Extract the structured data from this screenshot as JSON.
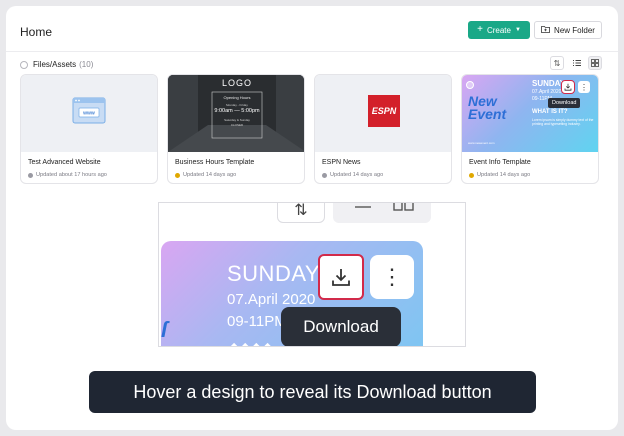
{
  "header": {
    "title": "Home",
    "create_label": "Create",
    "new_folder_label": "New Folder"
  },
  "files": {
    "label": "Files/Assets",
    "count": "(10)"
  },
  "cards": [
    {
      "name": "Test Advanced Website",
      "updated": "Updated about 17 hours ago",
      "status_color": "#9a9aa3"
    },
    {
      "name": "Business Hours Template",
      "updated": "Updated 14 days ago",
      "status_color": "#e0a800"
    },
    {
      "name": "ESPN News",
      "updated": "Updated 14 days ago",
      "status_color": "#9a9aa3"
    },
    {
      "name": "Event Info Template",
      "updated": "Updated 14 days ago",
      "status_color": "#e0a800"
    }
  ],
  "thumb_business": {
    "logo": "LOGO",
    "hours_title": "Opening Hours",
    "days": "Monday - Friday",
    "time": "9:00am — 5:00pm",
    "weekend": "Saturday & Sunday",
    "closed": "CLOSED"
  },
  "thumb_espn": {
    "logo": "ESPN"
  },
  "thumb_event": {
    "title1": "New",
    "title2": "Event",
    "day": "SUNDAY",
    "date": "07.April 2020",
    "time": "09-11PM",
    "what": "WHAT IS IT?",
    "body": "Lorem ipsum is simply dummy text of the printing and typesetting industry.",
    "url": "www.newevent.com"
  },
  "tooltip": {
    "label": "Download"
  },
  "zoom": {
    "day": "SUNDAY",
    "date": "07.April 2020",
    "time": "09-11PM",
    "tooltip": "Download"
  },
  "caption": "Hover a design to reveal its Download button",
  "colors": {
    "accent": "#1aa887",
    "highlight": "#d22a4a",
    "caption_bg": "#1f2633"
  }
}
